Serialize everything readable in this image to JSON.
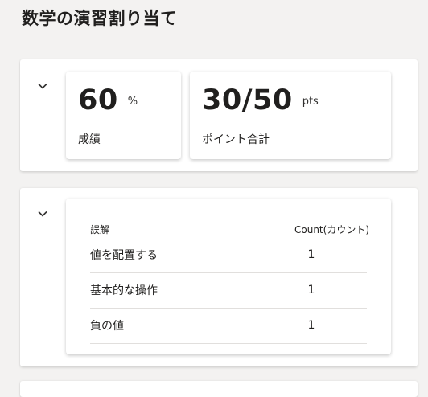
{
  "page": {
    "title": "数学の演習割り当て"
  },
  "summary": {
    "grade_value": "60",
    "grade_unit": "%",
    "grade_label": "成績",
    "points_value": "30/50",
    "points_unit": "pts",
    "points_label": "ポイント合計"
  },
  "mistakes": {
    "header_mistake": "誤解",
    "header_count": "Count(カウント)",
    "rows": [
      {
        "label": "値を配置する",
        "count": "1"
      },
      {
        "label": "基本的な操作",
        "count": "1"
      },
      {
        "label": "負の値",
        "count": "1"
      }
    ]
  },
  "icons": {
    "collapse": "chevron-down-icon"
  }
}
